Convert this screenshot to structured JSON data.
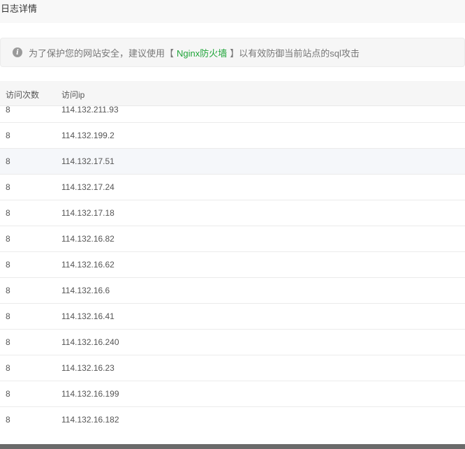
{
  "header": {
    "title": "日志详情"
  },
  "notice": {
    "prefix": "为了保护您的网站安全，建议使用【",
    "link": "Nginx防火墙",
    "suffix": "】以有效防御当前站点的sql攻击"
  },
  "table": {
    "columns": [
      "访问次数",
      "访问ip"
    ],
    "rows": [
      {
        "count": "8",
        "ip": "114.132.211.93"
      },
      {
        "count": "8",
        "ip": "114.132.199.2"
      },
      {
        "count": "8",
        "ip": "114.132.17.51"
      },
      {
        "count": "8",
        "ip": "114.132.17.24"
      },
      {
        "count": "8",
        "ip": "114.132.17.18"
      },
      {
        "count": "8",
        "ip": "114.132.16.82"
      },
      {
        "count": "8",
        "ip": "114.132.16.62"
      },
      {
        "count": "8",
        "ip": "114.132.16.6"
      },
      {
        "count": "8",
        "ip": "114.132.16.41"
      },
      {
        "count": "8",
        "ip": "114.132.16.240"
      },
      {
        "count": "8",
        "ip": "114.132.16.23"
      },
      {
        "count": "8",
        "ip": "114.132.16.199"
      },
      {
        "count": "8",
        "ip": "114.132.16.182"
      }
    ]
  },
  "colors": {
    "accent": "#20a53a",
    "row_hover": "#f5f7fa"
  }
}
